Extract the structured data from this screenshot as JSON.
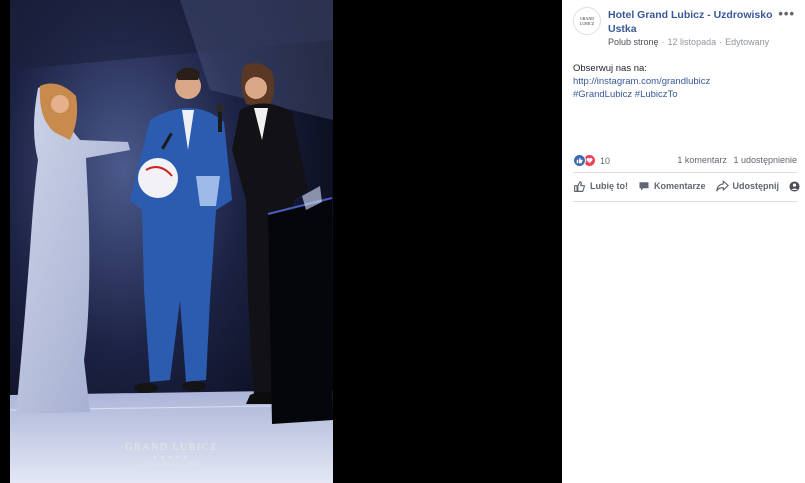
{
  "watermark": {
    "title": "GRAND LUBICZ",
    "stars": "★★★★★",
    "subtitle": "UZDROWISKO USTKA"
  },
  "page": {
    "avatar_lines": [
      "GRAND",
      "LUBICZ"
    ],
    "name": "Hotel Grand Lubicz - Uzdrowisko Ustka",
    "follow_label": "Polub stronę",
    "date": "12 listopada",
    "edited": "Edytowany",
    "more_label": "•••"
  },
  "post": {
    "lines": [
      "Obserwuj nas na:",
      "http://instagram.com/grandlubicz",
      "#GrandLubicz #LubiczTo"
    ]
  },
  "reactions": {
    "like_icon": "thumbs-up-icon",
    "love_icon": "heart-icon",
    "count": "10",
    "comments": "1 komentarz",
    "shares": "1 udostępnienie"
  },
  "actions": {
    "like": "Lubię to!",
    "comment": "Komentarze",
    "share": "Udostępnij"
  },
  "colors": {
    "link": "#385898",
    "like_blue": "#4267b2",
    "love_red": "#f33e58",
    "meta_gray": "#90949c"
  }
}
